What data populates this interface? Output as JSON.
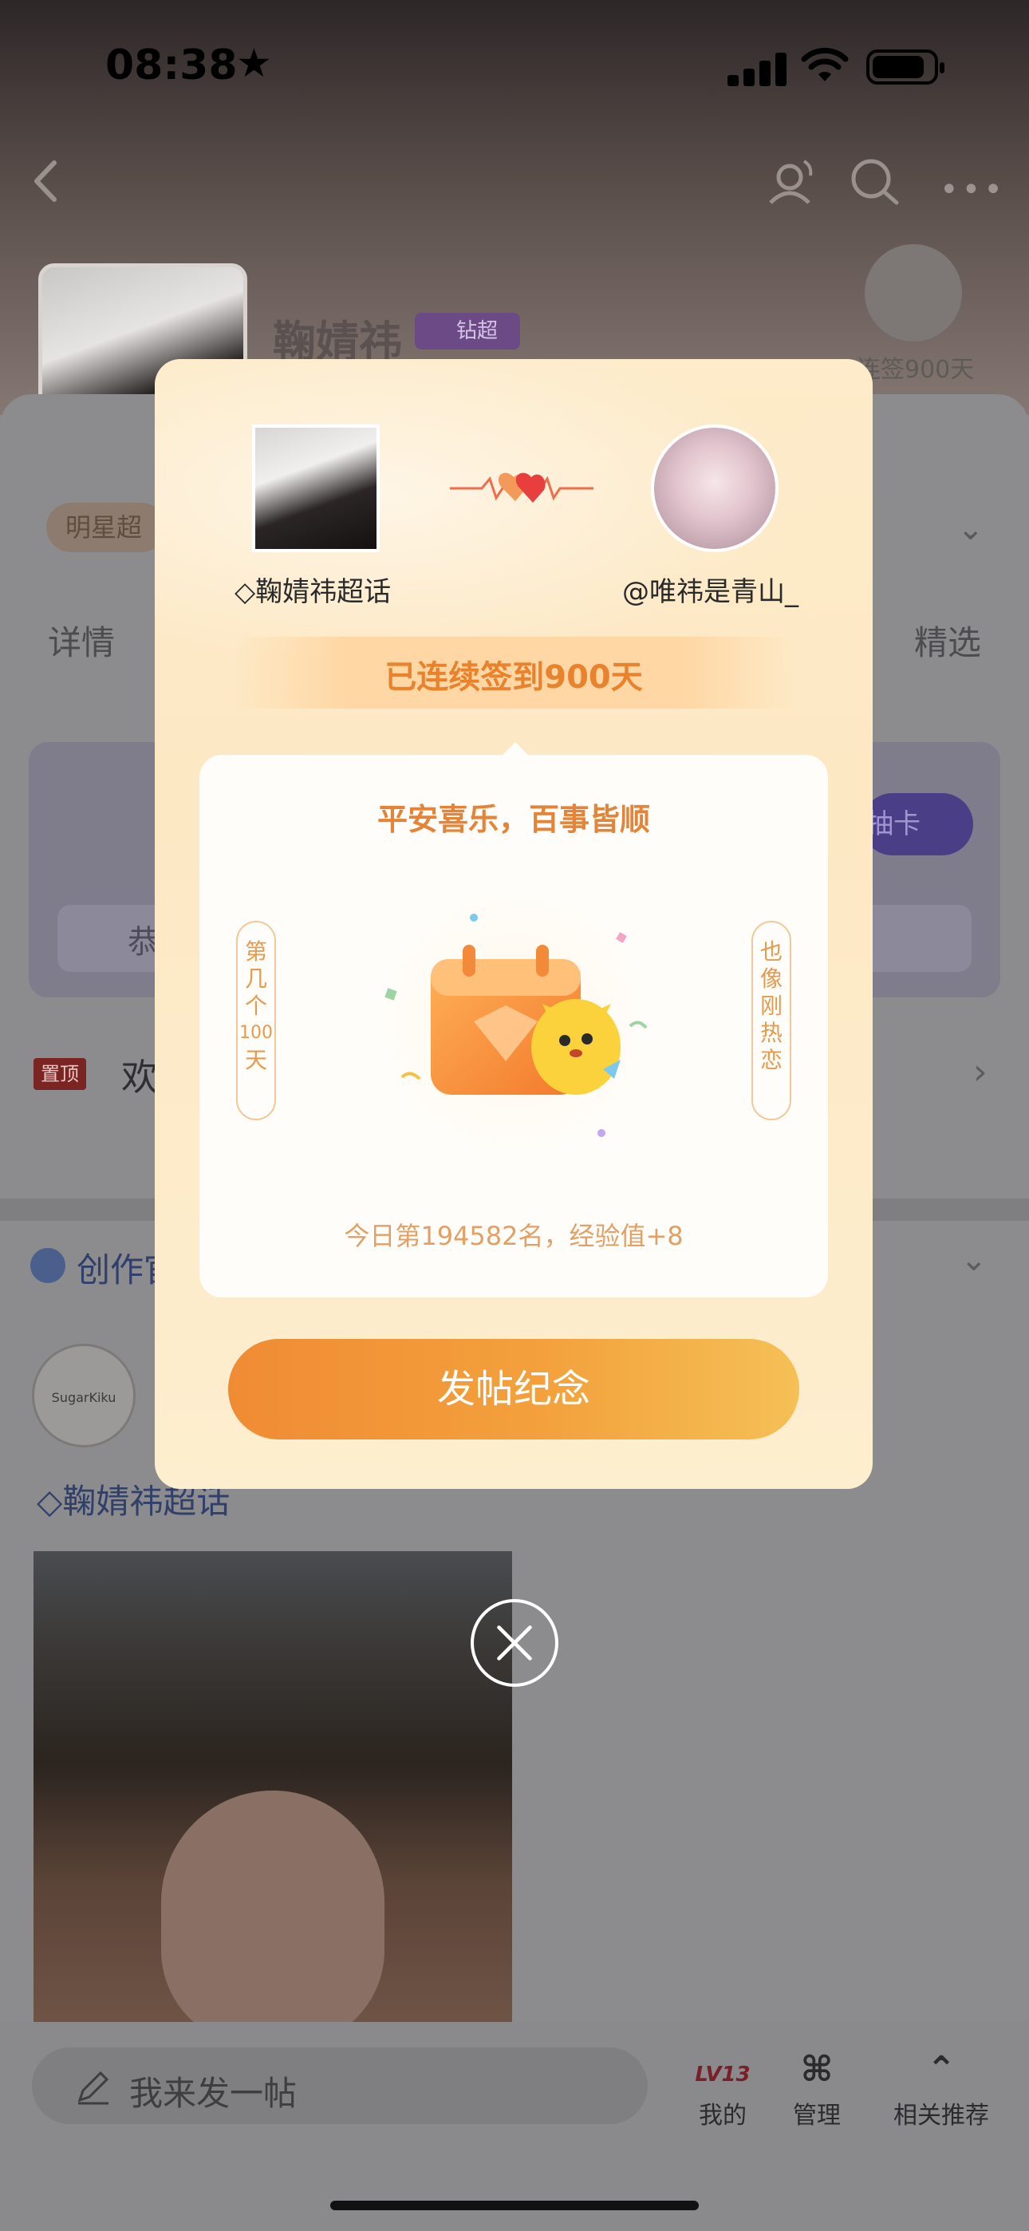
{
  "status_bar": {
    "time": "08:38",
    "star": "★"
  },
  "header": {
    "title": "鞠婧祎",
    "badge": "钻超",
    "checkin_label": "连签900天"
  },
  "tags": {
    "star_tag": "明星超"
  },
  "tabs": {
    "detail": "详情",
    "select": "精选"
  },
  "card": {
    "draw_button": "抽卡",
    "mini_text": "恭"
  },
  "pinned": {
    "badge": "置顶",
    "text": "欢"
  },
  "creator": {
    "label": "创作官"
  },
  "post": {
    "avatar_text": "SugarKiku",
    "topic": "鞠婧祎超话"
  },
  "bottom_bar": {
    "compose_placeholder": "我来发一帖",
    "mine_label": "我的",
    "mine_level": "LV13",
    "manage_label": "管理",
    "recommend_label": "相关推荐"
  },
  "modal": {
    "left_name": "鞠婧祎超话",
    "right_name": "@唯祎是青山_",
    "streak": "已连续签到900天",
    "blessing": "平安喜乐，百事皆顺",
    "left_banner": [
      "第",
      "几",
      "个",
      "100",
      "天"
    ],
    "right_banner": [
      "也",
      "像",
      "刚",
      "热",
      "恋"
    ],
    "rank": "今日第194582名，经验值+8",
    "post_button": "发帖纪念"
  },
  "colors": {
    "accent_orange": "#e9822d",
    "button_start": "#f08b34",
    "button_end": "#f5c056",
    "modal_bg": "#fdebc9"
  }
}
